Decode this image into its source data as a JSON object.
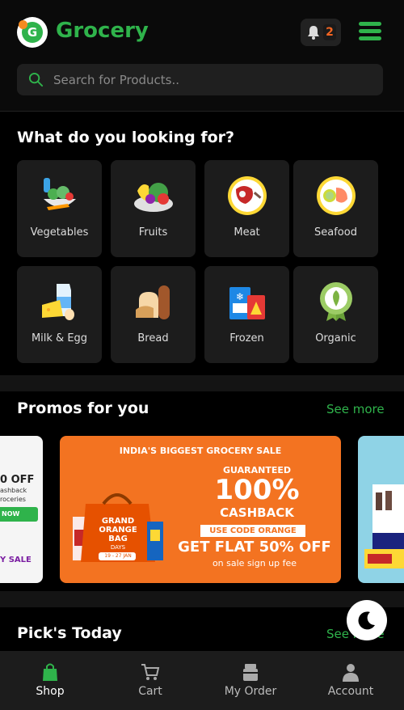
{
  "header": {
    "app_title": "Grocery",
    "logo_letter": "G",
    "notification_count": "2",
    "search_placeholder": "Search for Products.."
  },
  "categories_section": {
    "title": "What do you looking for?",
    "items": [
      {
        "label": "Vegetables",
        "icon": "vegetables-icon"
      },
      {
        "label": "Fruits",
        "icon": "fruits-icon"
      },
      {
        "label": "Meat",
        "icon": "meat-icon"
      },
      {
        "label": "Seafood",
        "icon": "seafood-icon"
      },
      {
        "label": "Milk & Egg",
        "icon": "milk-egg-icon"
      },
      {
        "label": "Bread",
        "icon": "bread-icon"
      },
      {
        "label": "Frozen",
        "icon": "frozen-icon"
      },
      {
        "label": "Organic",
        "icon": "organic-icon"
      }
    ]
  },
  "promos": {
    "title": "Promos for you",
    "see_more": "See more",
    "left_card": {
      "line1": "0 OFF",
      "line2": "ashback",
      "line3": "roceries",
      "button": "NOW",
      "tag": "Y SALE"
    },
    "main_card": {
      "headline": "INDIA'S BIGGEST GROCERY SALE",
      "guaranteed": "GUARANTEED",
      "percent": "100%",
      "cashback": "CASHBACK",
      "code": "USE CODE ORANGE",
      "flat": "GET FLAT 50% OFF",
      "subline": "on sale sign up fee",
      "bag_line1": "GRAND",
      "bag_line2": "ORANGE",
      "bag_line3": "BAG",
      "bag_line4": "DAYS",
      "dates": "19 - 27 JAN"
    }
  },
  "picks": {
    "title": "Pick's Today",
    "see_more": "See more"
  },
  "bottom_nav": {
    "items": [
      {
        "label": "Shop",
        "icon": "shop-bag-icon",
        "active": true
      },
      {
        "label": "Cart",
        "icon": "cart-icon",
        "active": false
      },
      {
        "label": "My Order",
        "icon": "order-box-icon",
        "active": false
      },
      {
        "label": "Account",
        "icon": "account-icon",
        "active": false
      }
    ]
  },
  "colors": {
    "brand_green": "#2fb34b",
    "accent_orange": "#f37321",
    "background": "#000000",
    "card": "#1c1c1c"
  }
}
